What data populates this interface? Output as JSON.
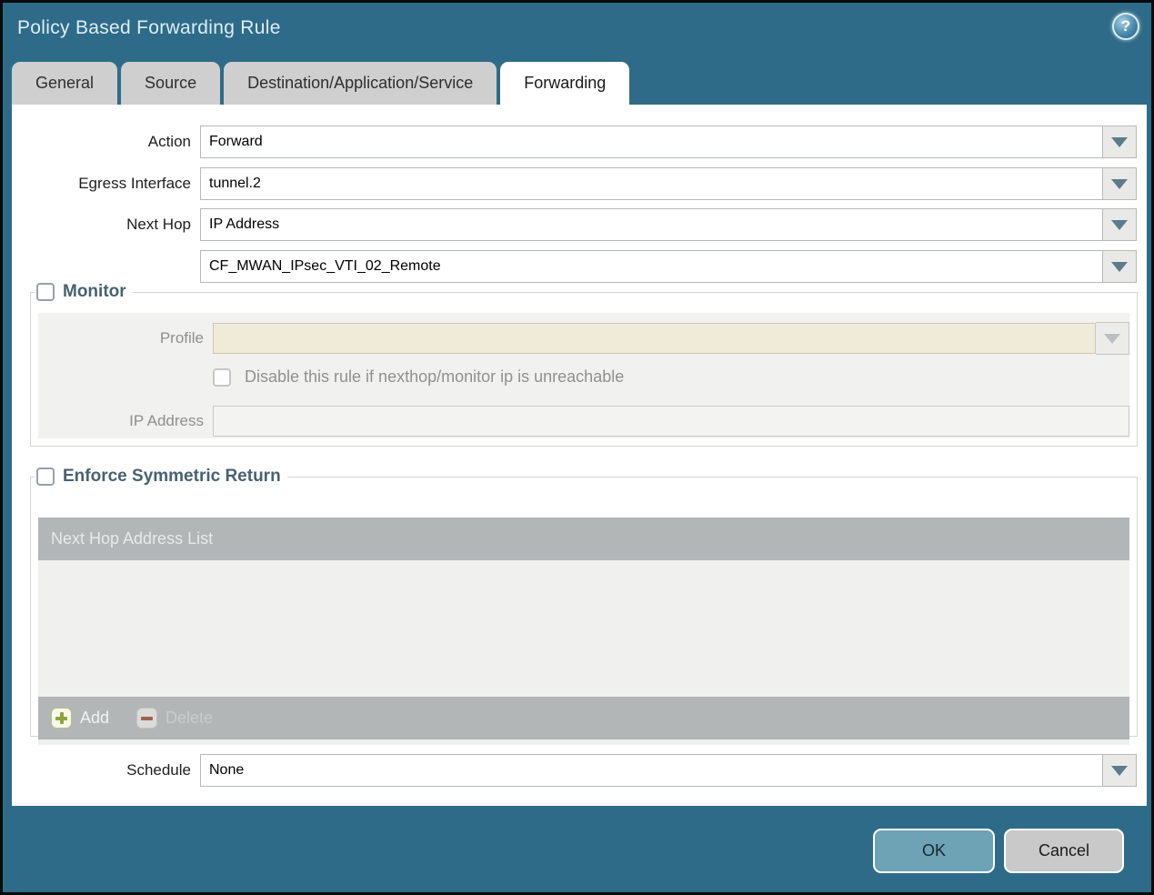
{
  "window": {
    "title": "Policy Based Forwarding Rule"
  },
  "icons": {
    "help": "?"
  },
  "tabs": [
    {
      "label": "General",
      "active": false
    },
    {
      "label": "Source",
      "active": false
    },
    {
      "label": "Destination/Application/Service",
      "active": false
    },
    {
      "label": "Forwarding",
      "active": true
    }
  ],
  "form": {
    "action": {
      "label": "Action",
      "value": "Forward"
    },
    "egress_interface": {
      "label": "Egress Interface",
      "value": "tunnel.2"
    },
    "next_hop": {
      "label": "Next Hop",
      "value": "IP Address"
    },
    "next_hop_address": {
      "value": "CF_MWAN_IPsec_VTI_02_Remote"
    },
    "monitor": {
      "label": "Monitor",
      "checked": false,
      "profile": {
        "label": "Profile",
        "value": ""
      },
      "disable_rule": {
        "label": "Disable this rule if nexthop/monitor ip is unreachable",
        "checked": false
      },
      "ip_address": {
        "label": "IP Address",
        "value": ""
      }
    },
    "enforce_symmetric_return": {
      "label": "Enforce Symmetric Return",
      "checked": false,
      "table": {
        "header": "Next Hop Address List",
        "rows": []
      },
      "add_label": "Add",
      "delete_label": "Delete",
      "delete_enabled": false
    },
    "schedule": {
      "label": "Schedule",
      "value": "None"
    }
  },
  "footer": {
    "ok_label": "OK",
    "cancel_label": "Cancel"
  },
  "colors": {
    "chrome_teal": "#2e6b89",
    "tab_inactive": "#cfcfcf",
    "tab_active": "#ffffff",
    "section_label": "#47626f",
    "disabled_beige_field": "#f0ead8",
    "disabled_panel": "#f1f1ef",
    "table_chrome": "#b2b6b7",
    "ok_button": "#6ea2b5",
    "cancel_button": "#c9c9c9",
    "add_icon_green": "#8ca43e",
    "delete_icon_red": "#9d5f55"
  }
}
